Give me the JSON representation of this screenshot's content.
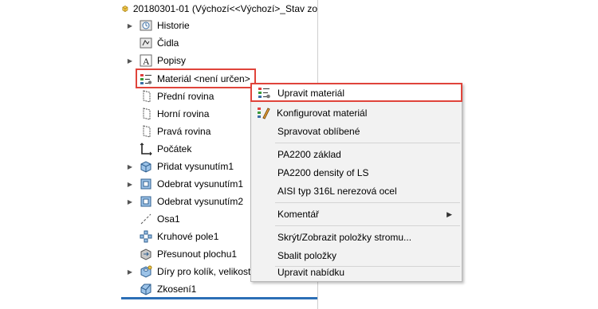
{
  "colors": {
    "highlight_border": "#e0443b",
    "panel_bottom_bar": "#2b6fb6",
    "menu_background": "#f2f2f2"
  },
  "tree": {
    "root_label": "20180301-01  (Výchozí<<Výchozí>_Stav zo",
    "root_icon": "part-icon",
    "items": [
      {
        "label": "Historie",
        "icon": "history-icon",
        "expandable": true
      },
      {
        "label": "Čidla",
        "icon": "sensors-icon",
        "expandable": false
      },
      {
        "label": "Popisy",
        "icon": "annotations-icon",
        "expandable": true
      },
      {
        "label": "Materiál <není určen>",
        "icon": "material-icon",
        "expandable": false
      },
      {
        "label": "Přední rovina",
        "icon": "plane-icon",
        "expandable": false
      },
      {
        "label": "Horní rovina",
        "icon": "plane-icon",
        "expandable": false
      },
      {
        "label": "Pravá rovina",
        "icon": "plane-icon",
        "expandable": false
      },
      {
        "label": "Počátek",
        "icon": "origin-icon",
        "expandable": false
      },
      {
        "label": "Přidat vysunutím1",
        "icon": "extrude-icon",
        "expandable": true
      },
      {
        "label": "Odebrat vysunutím1",
        "icon": "cut-extrude-icon",
        "expandable": true
      },
      {
        "label": "Odebrat vysunutím2",
        "icon": "cut-extrude-icon",
        "expandable": true
      },
      {
        "label": "Osa1",
        "icon": "axis-icon",
        "expandable": false
      },
      {
        "label": "Kruhové pole1",
        "icon": "circular-pattern-icon",
        "expandable": false
      },
      {
        "label": "Přesunout plochu1",
        "icon": "move-face-icon",
        "expandable": false
      },
      {
        "label": "Díry pro kolík, velikost",
        "icon": "hole-wizard-icon",
        "expandable": true
      },
      {
        "label": "Zkosení1",
        "icon": "chamfer-icon",
        "expandable": false
      }
    ]
  },
  "context_menu": {
    "items": [
      {
        "label": "Upravit materiál",
        "icon": "edit-material-icon"
      },
      {
        "label": "Konfigurovat materiál",
        "icon": "configure-material-icon"
      },
      {
        "label": "Spravovat oblíbené"
      },
      {
        "label": "PA2200 základ"
      },
      {
        "label": "PA2200 density of LS"
      },
      {
        "label": "AISI typ 316L nerezová ocel"
      },
      {
        "label": "Komentář",
        "submenu": true
      },
      {
        "label": "Skrýt/Zobrazit položky stromu..."
      },
      {
        "label": "Sbalit položky"
      },
      {
        "label": "Upravit nabídku"
      }
    ]
  }
}
